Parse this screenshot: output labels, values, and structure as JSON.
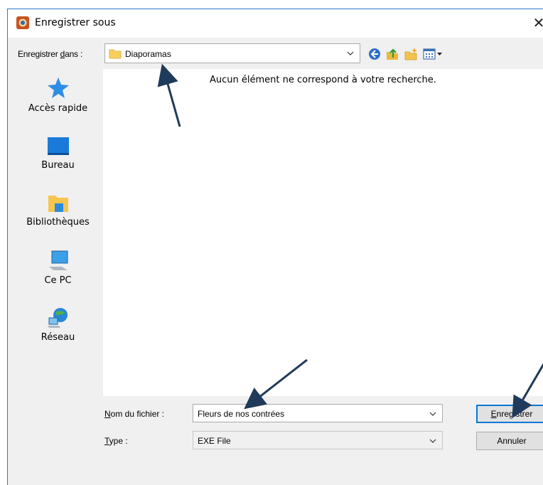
{
  "window": {
    "title": "Enregistrer sous",
    "close_glyph": "✕"
  },
  "location": {
    "label_pre": "Enregistrer ",
    "label_accel": "d",
    "label_post": "ans :",
    "value": "Diaporamas"
  },
  "toolbar": {
    "icons": [
      "back-icon",
      "up-folder-icon",
      "new-folder-icon",
      "view-menu-icon"
    ]
  },
  "sidebar": {
    "items": [
      {
        "label": "Accès rapide",
        "icon": "star-icon"
      },
      {
        "label": "Bureau",
        "icon": "desktop-icon"
      },
      {
        "label": "Bibliothèques",
        "icon": "libraries-icon"
      },
      {
        "label": "Ce PC",
        "icon": "computer-icon"
      },
      {
        "label": "Réseau",
        "icon": "network-icon"
      }
    ]
  },
  "file_list": {
    "empty_message": "Aucun élément ne correspond à votre recherche."
  },
  "filename": {
    "label_accel": "N",
    "label_post": "om du fichier :",
    "value": "Fleurs de nos contrées"
  },
  "filetype": {
    "label_accel": "T",
    "label_post": "ype :",
    "value": "EXE File"
  },
  "buttons": {
    "save_accel": "E",
    "save_post": "nregistrer",
    "cancel": "Annuler"
  },
  "colors": {
    "accent": "#0078d7",
    "arrow": "#1f3a5a"
  }
}
